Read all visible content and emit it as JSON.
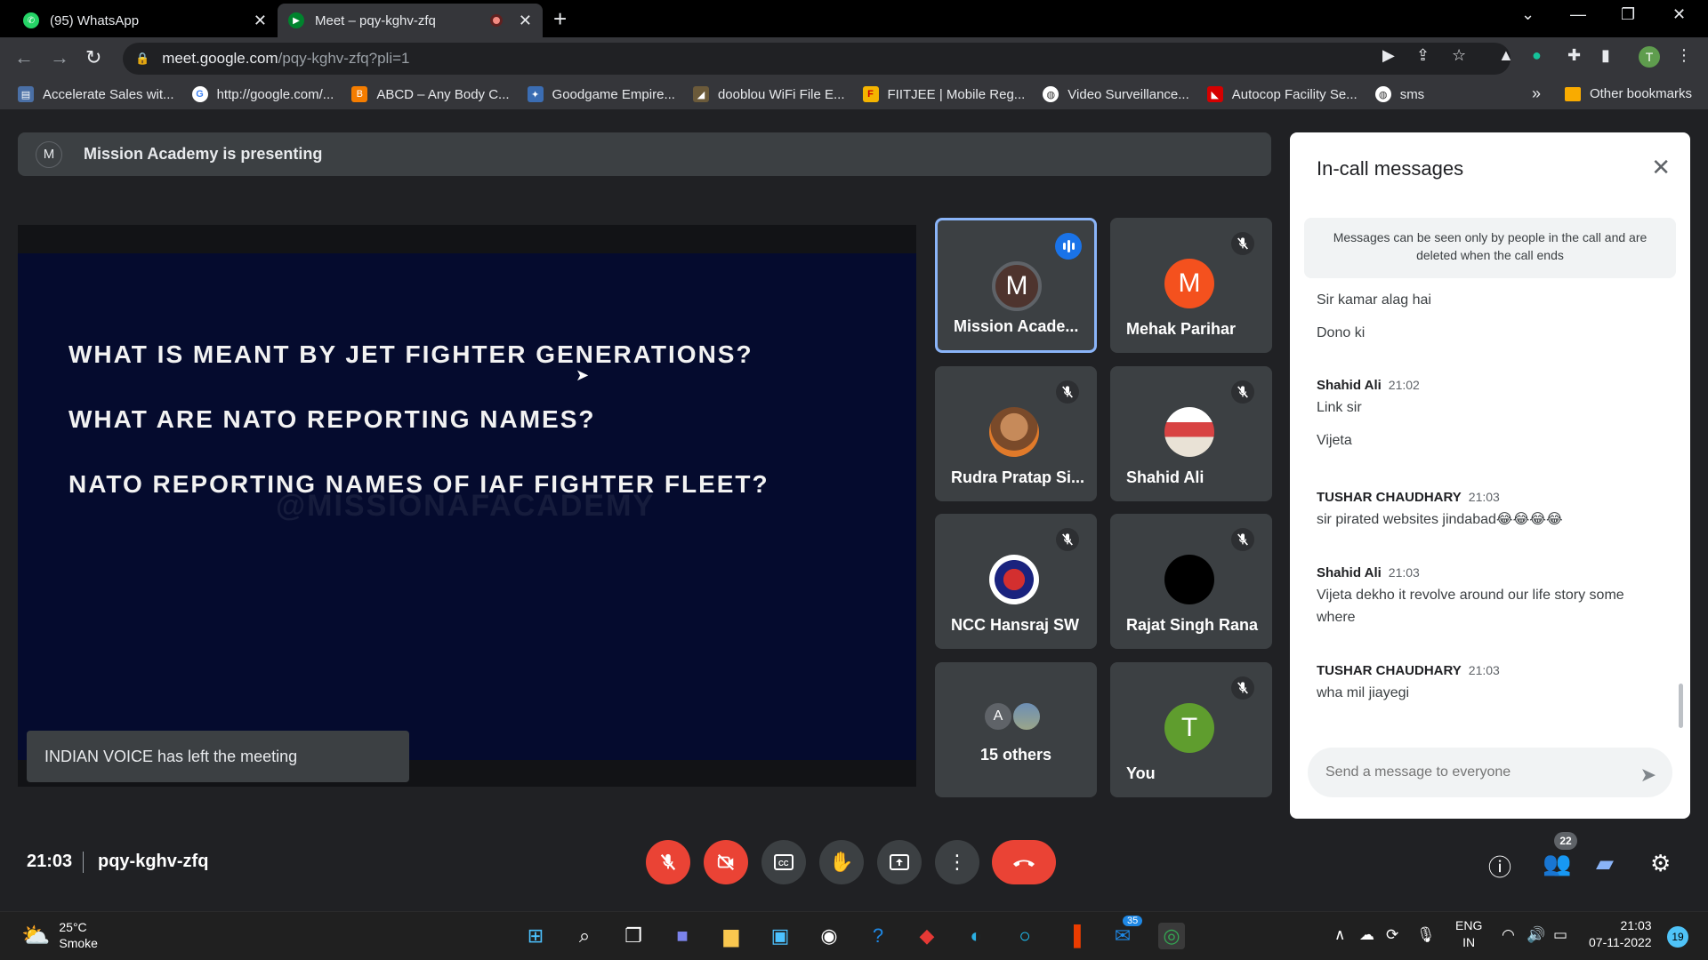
{
  "browser": {
    "tabs": [
      {
        "label": "(95) WhatsApp"
      },
      {
        "label": "Meet – pqy-kghv-zfq"
      }
    ],
    "url_host": "meet.google.com",
    "url_path": "/pqy-kghv-zfq?pli=1",
    "profile_initial": "T",
    "bookmarks": [
      {
        "label": "Accelerate Sales wit..."
      },
      {
        "label": "http://google.com/..."
      },
      {
        "label": "ABCD – Any Body C..."
      },
      {
        "label": "Goodgame Empire..."
      },
      {
        "label": "dooblou WiFi File E..."
      },
      {
        "label": "FIITJEE | Mobile Reg..."
      },
      {
        "label": "Video Surveillance..."
      },
      {
        "label": "Autocop Facility Se..."
      },
      {
        "label": "sms"
      }
    ],
    "other_bookmarks": "Other bookmarks"
  },
  "meet": {
    "presenter_initial": "M",
    "presenting_text": "Mission Academy is presenting",
    "slide": {
      "lines": [
        "WHAT IS MEANT BY JET FIGHTER GENERATIONS?",
        "WHAT ARE NATO REPORTING NAMES?",
        "NATO REPORTING NAMES OF IAF FIGHTER FLEET?"
      ],
      "watermark": "@MISSIONAFACADEMY"
    },
    "toast": "INDIAN VOICE has left the meeting",
    "participants": [
      {
        "name": "Mission Acade...",
        "initial": "M"
      },
      {
        "name": "Mehak Parihar",
        "initial": "M"
      },
      {
        "name": "Rudra Pratap Si...",
        "initial": ""
      },
      {
        "name": "Shahid Ali",
        "initial": ""
      },
      {
        "name": "NCC Hansraj SW",
        "initial": ""
      },
      {
        "name": "Rajat Singh Rana",
        "initial": ""
      },
      {
        "name": "15 others",
        "initial": "A"
      },
      {
        "name": "You",
        "initial": "T"
      }
    ],
    "meeting_time": "21:03",
    "meeting_code": "pqy-kghv-zfq",
    "participant_count": "22"
  },
  "chat": {
    "title": "In-call messages",
    "notice": "Messages can be seen only by people in the call and are deleted when the call ends",
    "messages": [
      {
        "sender": "",
        "time": "",
        "lines": [
          "Sir kamar alag hai",
          "Dono ki"
        ]
      },
      {
        "sender": "Shahid Ali",
        "time": "21:02",
        "lines": [
          "Link sir",
          "Vijeta"
        ]
      },
      {
        "sender": "TUSHAR CHAUDHARY",
        "time": "21:03",
        "lines": [
          "sir pirated websites jindabad😂😂😂😂"
        ]
      },
      {
        "sender": "Shahid Ali",
        "time": "21:03",
        "lines": [
          "Vijeta dekho it revolve around our life story some where"
        ]
      },
      {
        "sender": "TUSHAR CHAUDHARY",
        "time": "21:03",
        "lines": [
          "wha mil jiayegi"
        ]
      }
    ],
    "input_placeholder": "Send a message to everyone"
  },
  "taskbar": {
    "temperature": "25°C",
    "weather": "Smoke",
    "lang_1": "ENG",
    "lang_2": "IN",
    "time": "21:03",
    "date": "07-11-2022",
    "notifications": "19",
    "outlook_badge": "35"
  },
  "colors": {
    "meet_bg": "#202124",
    "tile_bg": "#3c4043",
    "danger": "#ea4335",
    "accent": "#1a73e8",
    "slide_bg": "#050b2e"
  }
}
